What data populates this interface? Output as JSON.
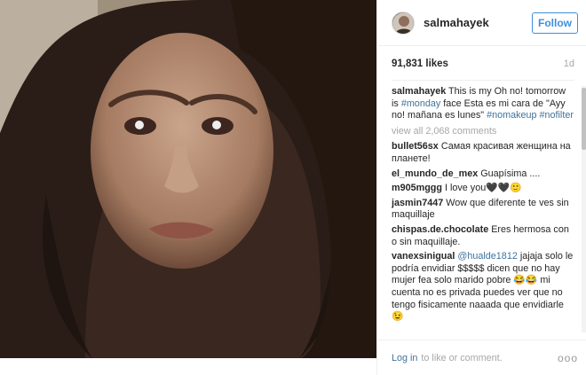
{
  "post": {
    "username": "salmahayek",
    "follow_label": "Follow",
    "likes": "91,831 likes",
    "time": "1d",
    "caption": {
      "username": "salmahayek",
      "text1": "This is my Oh no! tomorrow is",
      "tag1": "#monday",
      "text2": "face Esta es mi cara de \"Ayy no! mañana es lunes\"",
      "tag2": "#nomakeup",
      "tag3": "#nofilter"
    },
    "view_all": "view all 2,068 comments",
    "comments": [
      {
        "user": "bullet56sx",
        "text": "Самая красивая женщина на планете!"
      },
      {
        "user": "el_mundo_de_mex",
        "text": "Guapísima ...."
      },
      {
        "user": "m905mggg",
        "text": "I love you🖤🖤🙂"
      },
      {
        "user": "jasmin7447",
        "text": "Wow que diferente te ves sin maquillaje"
      },
      {
        "user": "chispas.de.chocolate",
        "text": "Eres hermosa con o sin maquillaje."
      }
    ],
    "last_comment": {
      "user": "vanexsinigual",
      "mention": "@hualde1812",
      "text": "jajaja solo le podría envidiar $$$$$ dicen que no hay mujer fea solo marido pobre 😂😂 mi cuenta no es privada puedes ver que no tengo fisicamente naaada que envidiarle 😉"
    },
    "footer": {
      "login": "Log in",
      "rest": "to like or comment.",
      "more": "ooo"
    }
  }
}
